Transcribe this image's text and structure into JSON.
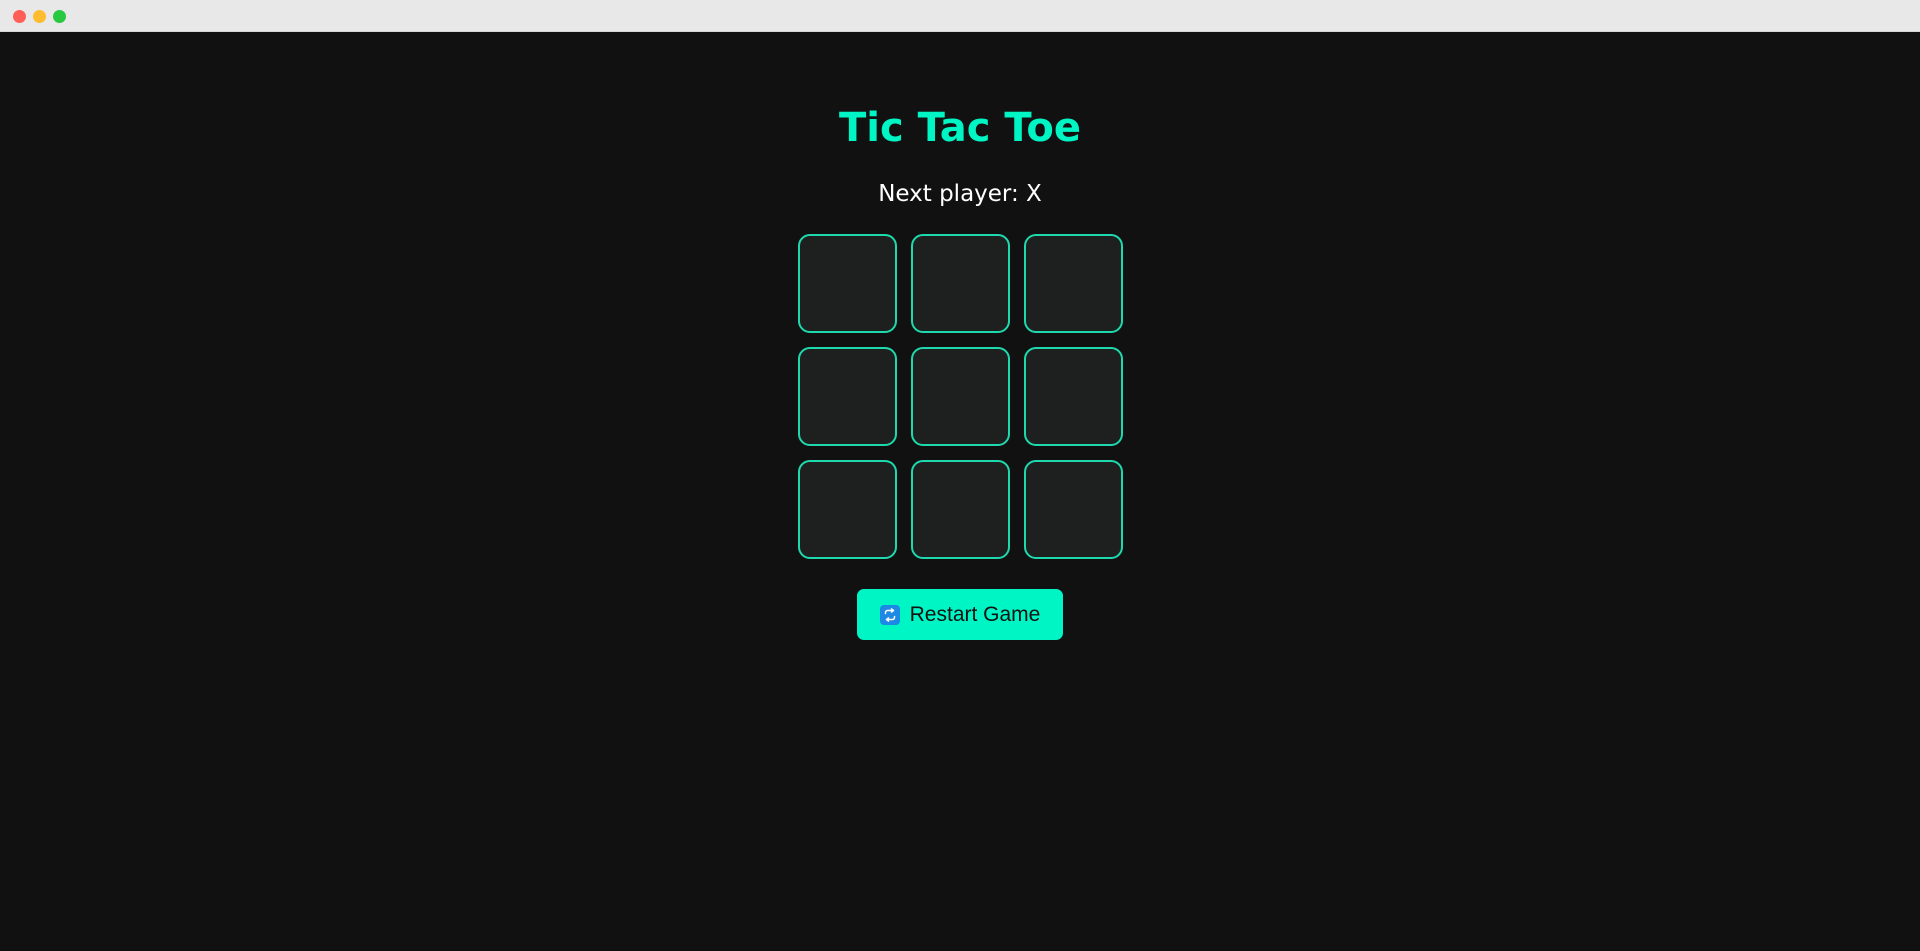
{
  "game": {
    "title": "Tic Tac Toe",
    "status": "Next player: X",
    "cells": [
      "",
      "",
      "",
      "",
      "",
      "",
      "",
      "",
      ""
    ],
    "restart_label": "Restart Game",
    "restart_icon": "repeat-icon"
  },
  "colors": {
    "accent": "#00f5c4",
    "background": "#111111",
    "cell_background": "#1e1f1f",
    "cell_border": "#1fd9ae",
    "icon_background": "#1e88e5"
  }
}
